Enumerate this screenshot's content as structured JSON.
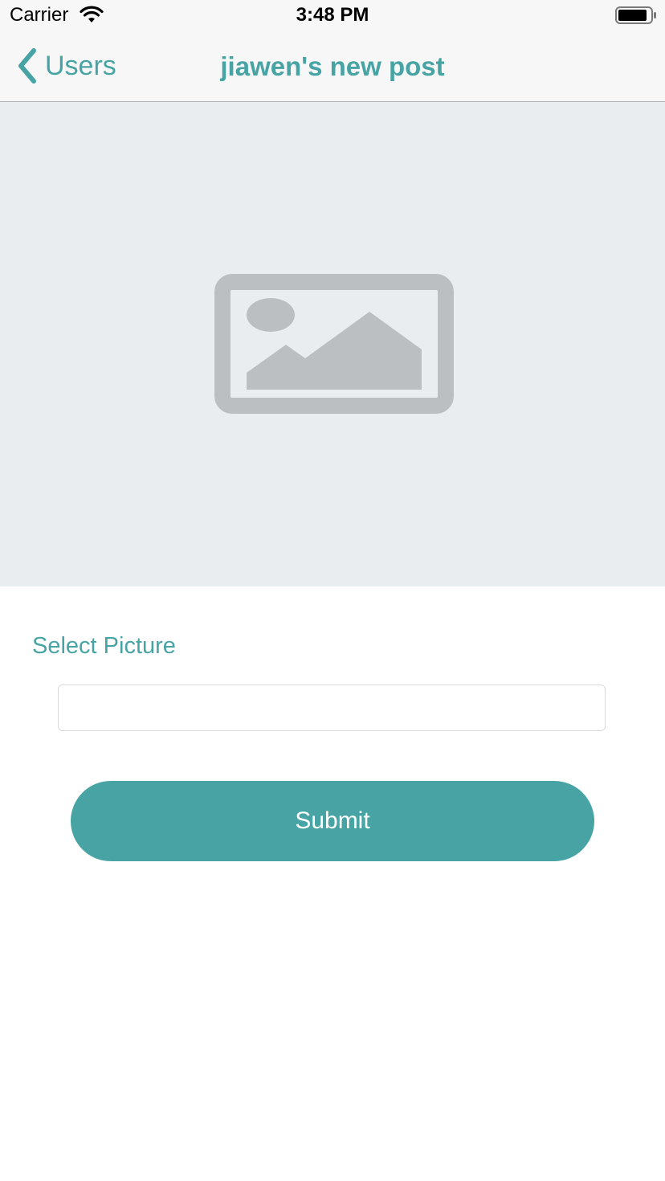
{
  "status_bar": {
    "carrier": "Carrier",
    "time": "3:48 PM",
    "icons": [
      "wifi-icon",
      "battery-icon"
    ]
  },
  "nav_bar": {
    "back_label": "Users",
    "title": "jiawen's new post",
    "back_icon": "chevron-left-icon"
  },
  "image_preview": {
    "placeholder_icon": "image-placeholder-icon"
  },
  "form": {
    "select_picture_label": "Select Picture",
    "caption_value": "",
    "caption_placeholder": "",
    "submit_label": "Submit"
  },
  "colors": {
    "accent": "#48a4a4",
    "preview_bg": "#e9edf0",
    "placeholder_gray": "#bbbfc2",
    "bar_bg": "#f7f7f7"
  }
}
